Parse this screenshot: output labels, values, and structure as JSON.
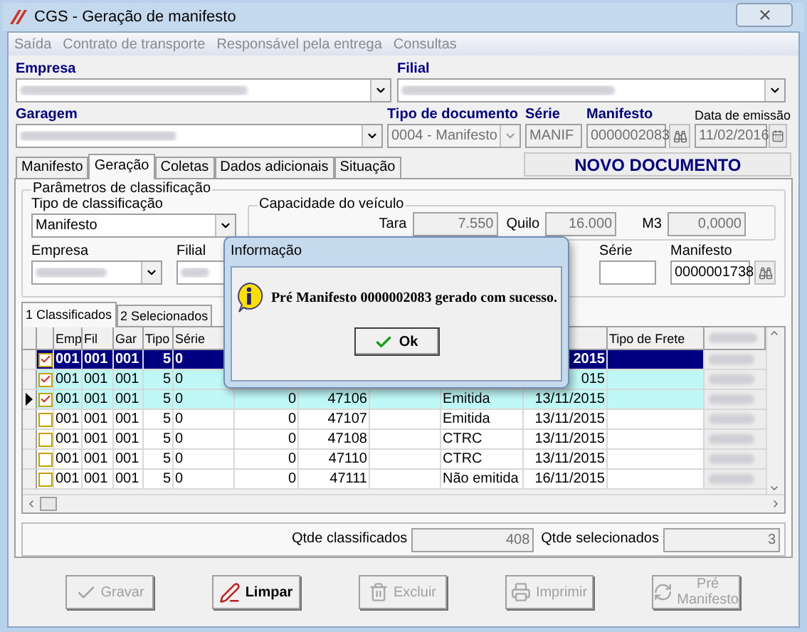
{
  "window": {
    "title": "CGS - Geração de manifesto"
  },
  "menu": [
    "Saída",
    "Contrato de transporte",
    "Responsável pela entrega",
    "Consultas"
  ],
  "header": {
    "empresa_label": "Empresa",
    "filial_label": "Filial",
    "garagem_label": "Garagem",
    "tipo_documento_label": "Tipo de documento",
    "tipo_documento": "0004 - Manifesto",
    "serie_label": "Série",
    "serie": "MANIF",
    "manifesto_label": "Manifesto",
    "manifesto": "0000002083",
    "data_label": "Data de emissão",
    "data": "11/02/2016"
  },
  "tabs": [
    {
      "label": "Manifesto",
      "selected": false
    },
    {
      "label": "Geração",
      "selected": true
    },
    {
      "label": "Coletas",
      "selected": false
    },
    {
      "label": "Dados adicionais",
      "selected": false
    },
    {
      "label": "Situação",
      "selected": false
    }
  ],
  "status_text": "NOVO DOCUMENTO",
  "params": {
    "title": "Parâmetros de classificação",
    "tipo_label": "Tipo de classificação",
    "tipo": "Manifesto",
    "empresa_label": "Empresa",
    "filial_label": "Filial",
    "serie_label": "Série",
    "manifesto_label": "Manifesto",
    "manifesto": "0000001738"
  },
  "capacity": {
    "title": "Capacidade do veículo",
    "tara_label": "Tara",
    "tara": "7.550",
    "quilo_label": "Quilo",
    "quilo": "16.000",
    "m3_label": "M3",
    "m3": "0,0000"
  },
  "subtabs": [
    {
      "label": "1 Classificados",
      "selected": true
    },
    {
      "label": "2 Selecionados",
      "selected": false
    }
  ],
  "table": {
    "columns": [
      "Emp",
      "Fil",
      "Gar",
      "Tipo",
      "Série",
      null,
      null,
      null,
      null,
      null,
      "Tipo de Frete"
    ],
    "rows": [
      {
        "selected": true,
        "checked": true,
        "current": false,
        "cells": [
          "001",
          "001",
          "001",
          "5",
          "0",
          null,
          null,
          null,
          null,
          "2015",
          null
        ]
      },
      {
        "selected": false,
        "checked": true,
        "current": false,
        "cells": [
          "001",
          "001",
          "001",
          "5",
          "0",
          null,
          null,
          null,
          null,
          "015",
          null
        ]
      },
      {
        "selected": false,
        "checked": true,
        "current": true,
        "cells": [
          "001",
          "001",
          "001",
          "5",
          "0",
          "0",
          "47106",
          null,
          "Emitida",
          "13/11/2015",
          null
        ]
      },
      {
        "selected": false,
        "checked": false,
        "current": false,
        "cells": [
          "001",
          "001",
          "001",
          "5",
          "0",
          "0",
          "47107",
          null,
          "Emitida",
          "13/11/2015",
          null
        ]
      },
      {
        "selected": false,
        "checked": false,
        "current": false,
        "cells": [
          "001",
          "001",
          "001",
          "5",
          "0",
          "0",
          "47108",
          null,
          "CTRC",
          "13/11/2015",
          null
        ]
      },
      {
        "selected": false,
        "checked": false,
        "current": false,
        "cells": [
          "001",
          "001",
          "001",
          "5",
          "0",
          "0",
          "47110",
          null,
          "CTRC",
          "13/11/2015",
          null
        ]
      },
      {
        "selected": false,
        "checked": false,
        "current": false,
        "cells": [
          "001",
          "001",
          "001",
          "5",
          "0",
          "0",
          "47111",
          null,
          "Não emitida",
          "16/11/2015",
          null
        ]
      }
    ]
  },
  "totals": {
    "classificados_label": "Qtde classificados",
    "classificados": "408",
    "selecionados_label": "Qtde selecionados",
    "selecionados": "3"
  },
  "buttons": [
    {
      "kind": "save",
      "label": "Gravar",
      "disabled": true
    },
    {
      "kind": "clear",
      "label": "Limpar",
      "disabled": false
    },
    {
      "kind": "delete",
      "label": "Excluir",
      "disabled": true
    },
    {
      "kind": "print",
      "label": "Imprimir",
      "disabled": true
    },
    {
      "kind": "refresh",
      "label": "Pré Manifesto",
      "disabled": true
    }
  ],
  "dialog": {
    "title": "Informação",
    "message": "Pré Manifesto 0000002083 gerado com sucesso.",
    "ok": "Ok"
  }
}
